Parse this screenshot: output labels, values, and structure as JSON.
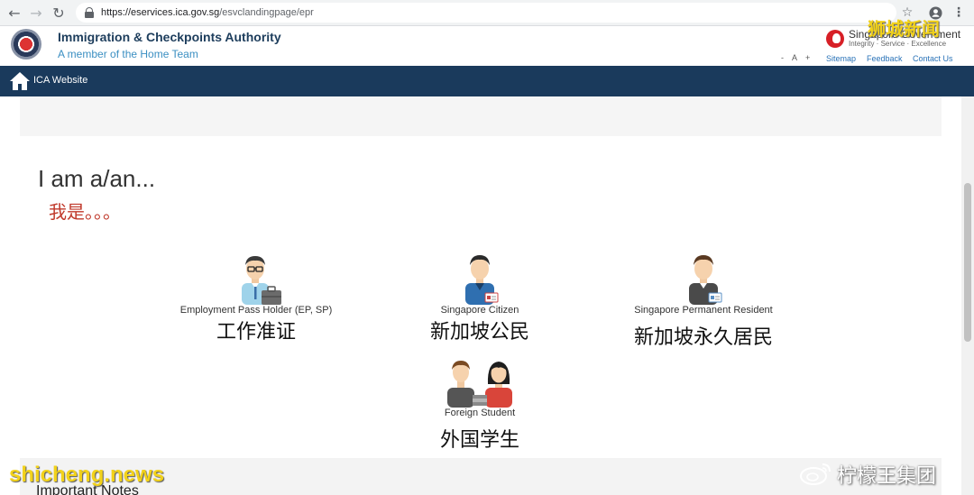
{
  "browser": {
    "url_host": "https://eservices.ica.gov.sg",
    "url_path": "/esvclandingpage/epr"
  },
  "header": {
    "org_name": "Immigration & Checkpoints Authority",
    "org_sub": "A member of the Home Team",
    "sg_title": "Singapore Government",
    "sg_motto": "Integrity · Service · Excellence",
    "font_minus": "-",
    "font_reset": "A",
    "font_plus": "+",
    "links": [
      "Sitemap",
      "Feedback",
      "Contact Us"
    ]
  },
  "nav": {
    "home_label": "ICA Website"
  },
  "main": {
    "heading_en": "I am a/an...",
    "heading_zh": "我是。。。",
    "options": [
      {
        "label_en": "Employment Pass Holder (EP, SP)",
        "label_zh": "工作准证"
      },
      {
        "label_en": "Singapore Citizen",
        "label_zh": "新加坡公民"
      },
      {
        "label_en": "Singapore Permanent Resident",
        "label_zh": "新加坡永久居民"
      },
      {
        "label_en": "Foreign Student",
        "label_zh": "外国学生"
      }
    ],
    "important_notes": "Important Notes"
  },
  "watermarks": {
    "top_right": "狮城新闻",
    "bottom_left": "shicheng.news",
    "bottom_right": "柠檬王集团"
  },
  "colors": {
    "navbar": "#1a3a5c",
    "accent_red": "#c0392b",
    "link_blue": "#2a73b8"
  }
}
